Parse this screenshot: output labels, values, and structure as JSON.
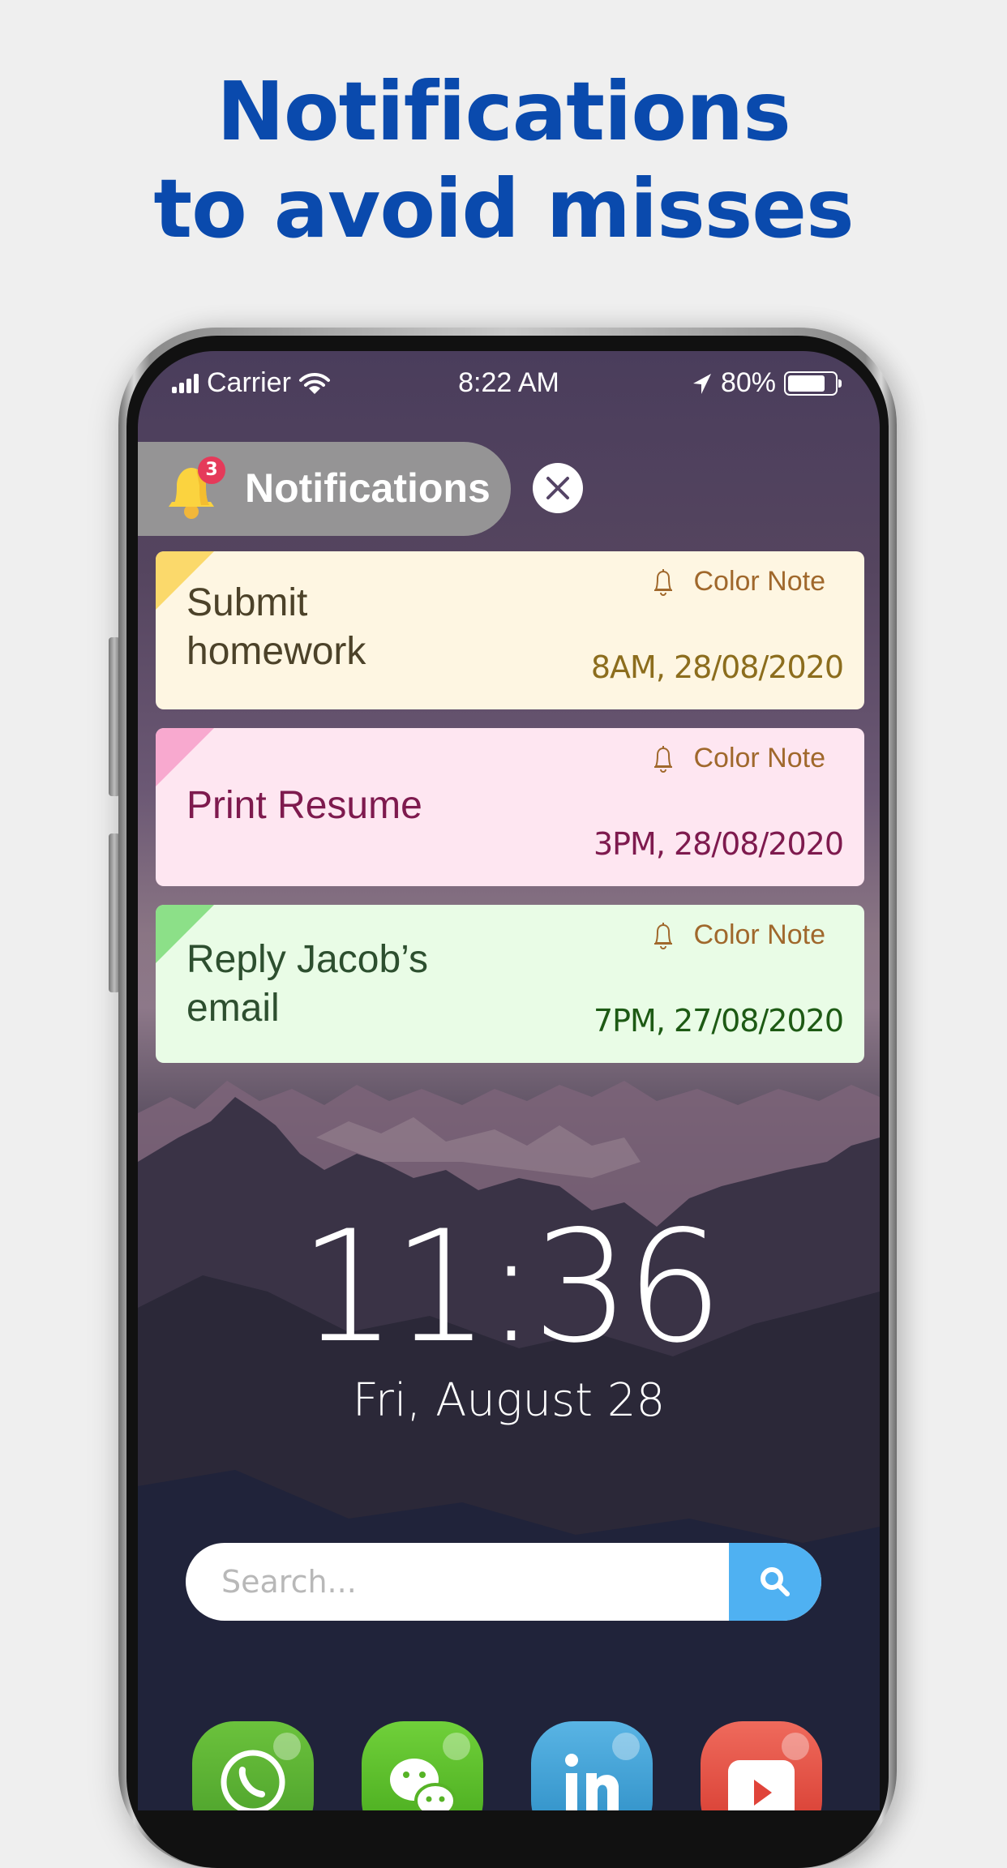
{
  "headline": {
    "line1": "Notifications",
    "line2": "to avoid misses"
  },
  "status_bar": {
    "carrier": "Carrier",
    "time": "8:22 AM",
    "battery": "80%",
    "battery_level": 0.8
  },
  "notifications_header": {
    "title": "Notifications",
    "badge_count": "3"
  },
  "cards": [
    {
      "title": "Submit\nhomework",
      "source": "Color Note",
      "when": "8AM, 28/08/2020",
      "bg": "#fef6e2",
      "corner": "#fbd96b",
      "title_color": "#4c4229",
      "when_color": "#8c6d1d"
    },
    {
      "title": "Print Resume",
      "source": "Color Note",
      "when": "3PM, 28/08/2020",
      "bg": "#fee6f1",
      "corner": "#f8a9cf",
      "title_color": "#7e1a4e",
      "when_color": "#7e1a4e"
    },
    {
      "title": "Reply Jacob’s\nemail",
      "source": "Color Note",
      "when": "7PM, 27/08/2020",
      "bg": "#e9fce6",
      "corner": "#8ce088",
      "title_color": "#2d4f2f",
      "when_color": "#1d5a14"
    }
  ],
  "lockscreen": {
    "time": "11:36",
    "date": "Fri, August 28"
  },
  "search": {
    "placeholder": "Search..."
  },
  "dock": [
    {
      "name": "WhatsApp",
      "icon": "whatsapp-icon"
    },
    {
      "name": "WeChat",
      "icon": "wechat-icon"
    },
    {
      "name": "LinkedIn",
      "icon": "linkedin-icon"
    },
    {
      "name": "YouTube",
      "icon": "youtube-icon"
    }
  ]
}
